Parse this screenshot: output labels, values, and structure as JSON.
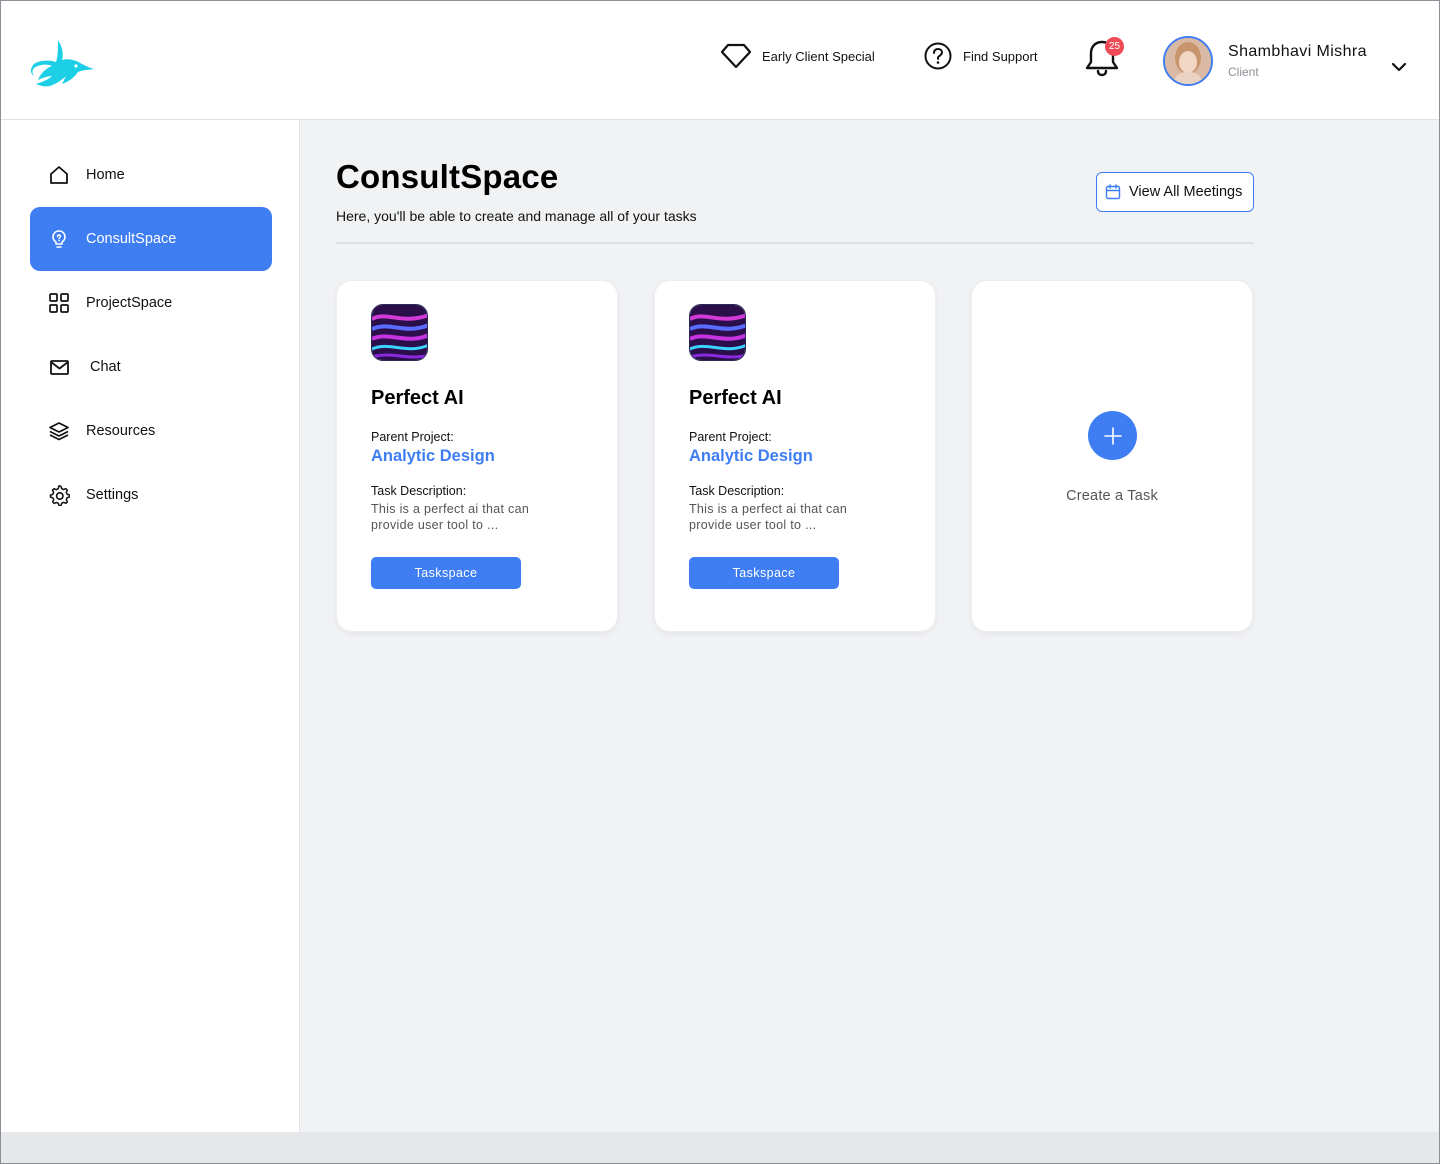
{
  "header": {
    "early_client": "Early Client Special",
    "support": "Find Support",
    "notification_count": "25",
    "user_name": "Shambhavi Mishra",
    "user_role": "Client"
  },
  "sidebar": {
    "items": [
      {
        "label": "Home",
        "icon": "home-icon"
      },
      {
        "label": "ConsultSpace",
        "icon": "lightbulb-icon",
        "active": true
      },
      {
        "label": "ProjectSpace",
        "icon": "grid-icon"
      },
      {
        "label": "Chat",
        "icon": "mail-icon"
      },
      {
        "label": "Resources",
        "icon": "layers-icon"
      },
      {
        "label": "Settings",
        "icon": "gear-icon"
      }
    ]
  },
  "main": {
    "title": "ConsultSpace",
    "subtitle": "Here, you'll be able to create and manage all of your tasks",
    "meetings_button": "View All Meetings",
    "cards": [
      {
        "title": "Perfect AI",
        "parent_label": "Parent Project:",
        "parent_project": "Analytic Design",
        "desc_label": "Task Description:",
        "description": "This is a perfect ai that can provide user tool to ...",
        "button": "Taskspace"
      },
      {
        "title": "Perfect AI",
        "parent_label": "Parent Project:",
        "parent_project": "Analytic Design",
        "desc_label": "Task Description:",
        "description": "This is a perfect ai that can provide user tool to ...",
        "button": "Taskspace"
      }
    ],
    "create_label": "Create a Task"
  },
  "colors": {
    "accent": "#3e7ef2",
    "logo": "#1ccfe6",
    "badge": "#ef4b57",
    "background": "#f1f2f4"
  }
}
